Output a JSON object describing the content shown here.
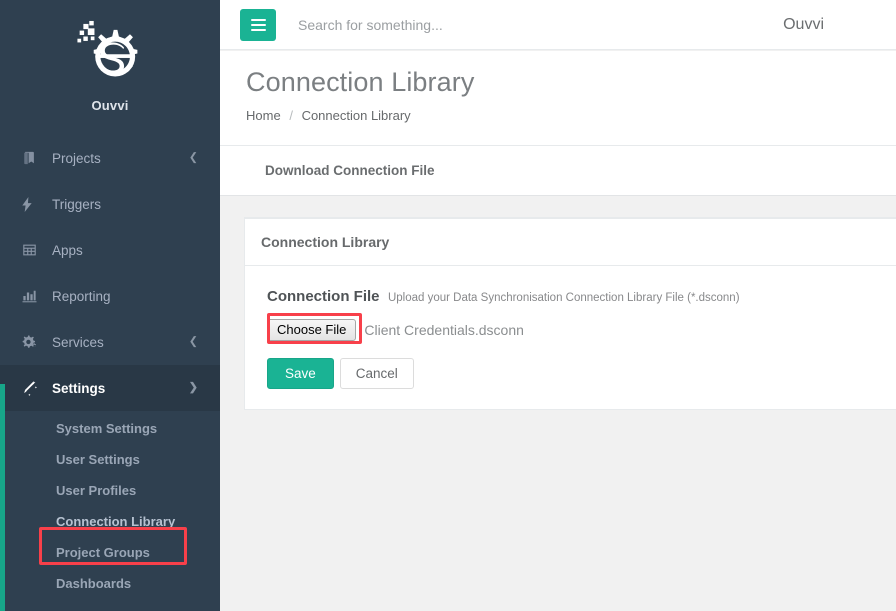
{
  "theme": {
    "sidebar_bg": "#2f4050",
    "sidebar_active_bg": "#293846",
    "accent_green": "#1ab394",
    "accent_bar_green": "#17a689",
    "highlight_red": "#f8404a",
    "content_bg": "#f1f1f1",
    "card_bg": "#ffffff",
    "text_muted": "#676a6c"
  },
  "sidebar": {
    "brand": {
      "logo_icon": "gear-s-logo-icon",
      "name": "Ouvvi"
    },
    "items": [
      {
        "label": "Projects",
        "icon": "book-icon",
        "chevron": "chevron-left-icon",
        "active": false
      },
      {
        "label": "Triggers",
        "icon": "bolt-icon",
        "chevron": "",
        "active": false
      },
      {
        "label": "Apps",
        "icon": "table-icon",
        "chevron": "",
        "active": false
      },
      {
        "label": "Reporting",
        "icon": "bar-chart-icon",
        "chevron": "",
        "active": false
      },
      {
        "label": "Services",
        "icon": "gears-icon",
        "chevron": "chevron-left-icon",
        "active": false
      },
      {
        "label": "Settings",
        "icon": "magic-wand-icon",
        "chevron": "chevron-down-icon",
        "active": true
      }
    ],
    "subitems": [
      {
        "label": "System Settings",
        "highlighted": false
      },
      {
        "label": "User Settings",
        "highlighted": false
      },
      {
        "label": "User Profiles",
        "highlighted": false
      },
      {
        "label": "Connection Library",
        "highlighted": true
      },
      {
        "label": "Project Groups",
        "highlighted": false
      },
      {
        "label": "Dashboards",
        "highlighted": false
      }
    ]
  },
  "header": {
    "menu_toggle_icon": "hamburger-icon",
    "search": {
      "placeholder": "Search for something...",
      "value": ""
    },
    "user_label": "Ouvvi"
  },
  "page": {
    "title": "Connection Library",
    "breadcrumb": {
      "home": "Home",
      "separator": "/",
      "current": "Connection Library"
    }
  },
  "toolbar": {
    "download_link": "Download Connection File"
  },
  "card": {
    "title": "Connection Library",
    "field": {
      "label": "Connection File",
      "hint": "Upload your Data Synchronisation Connection Library File (*.dsconn)",
      "choose_file_button": "Choose File",
      "selected_file_name": "Client Credentials.dsconn"
    },
    "actions": {
      "save_label": "Save",
      "cancel_label": "Cancel"
    }
  }
}
